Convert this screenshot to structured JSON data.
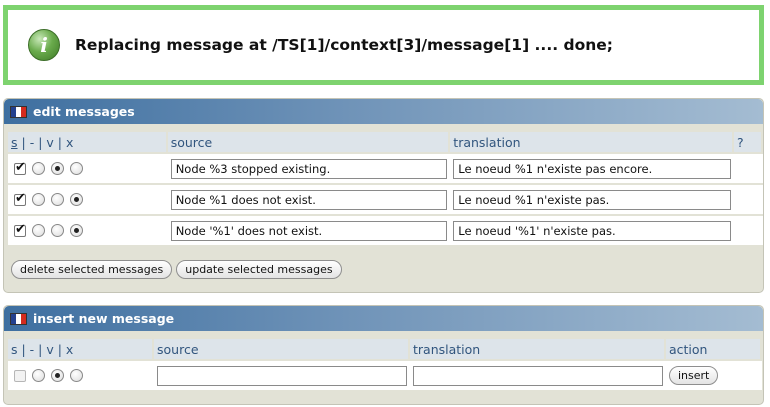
{
  "message": {
    "text": "Replacing message at /TS[1]/context[3]/message[1] .... done;"
  },
  "edit_panel": {
    "title": "edit messages",
    "headers": {
      "s": "s",
      "sep1": "|",
      "dash": "-",
      "sep2": "|",
      "v": "v",
      "sep3": "|",
      "x": "x",
      "source": "source",
      "translation": "translation",
      "help": "?"
    },
    "rows": [
      {
        "checked": true,
        "state": "v",
        "source": "Node %3 stopped existing.",
        "translation": "Le noeud %1 n'existe pas encore."
      },
      {
        "checked": true,
        "state": "x",
        "source": "Node %1 does not exist.",
        "translation": "Le noeud %1 n'existe pas."
      },
      {
        "checked": true,
        "state": "x",
        "source": "Node '%1' does not exist.",
        "translation": "Le noeud '%1' n'existe pas."
      }
    ],
    "buttons": {
      "delete": "delete selected messages",
      "update": "update selected messages"
    }
  },
  "insert_panel": {
    "title": "insert new message",
    "headers": {
      "svx": "s | - | v | x",
      "source": "source",
      "translation": "translation",
      "action": "action"
    },
    "row": {
      "checked": false,
      "state": "v",
      "source": "",
      "translation": ""
    },
    "insert_label": "insert"
  }
}
